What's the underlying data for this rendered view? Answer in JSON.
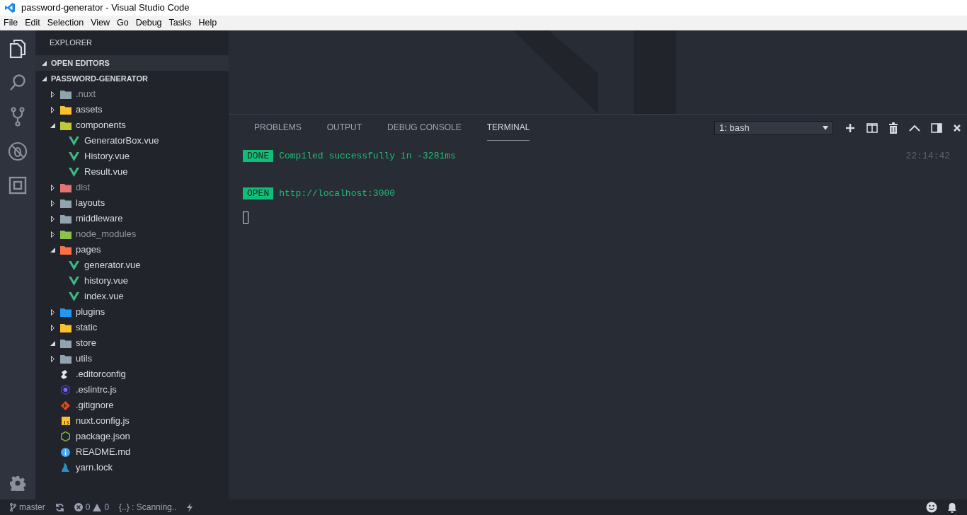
{
  "window": {
    "title": "password-generator - Visual Studio Code"
  },
  "menu": [
    "File",
    "Edit",
    "Selection",
    "View",
    "Go",
    "Debug",
    "Tasks",
    "Help"
  ],
  "sidebar": {
    "title": "EXPLORER",
    "sections": [
      {
        "label": "OPEN EDITORS",
        "expanded": true
      },
      {
        "label": "PASSWORD-GENERATOR",
        "expanded": true
      }
    ],
    "tree": [
      {
        "name": ".nuxt",
        "kind": "folder",
        "expanded": false,
        "ignored": true,
        "color": "#90a4ae"
      },
      {
        "name": "assets",
        "kind": "folder",
        "expanded": false,
        "ignored": false,
        "color": "#fbc02d"
      },
      {
        "name": "components",
        "kind": "folder",
        "expanded": true,
        "ignored": false,
        "color": "#c0ca33",
        "children": [
          {
            "name": "GeneratorBox.vue",
            "kind": "vue",
            "ignored": false
          },
          {
            "name": "History.vue",
            "kind": "vue",
            "ignored": false
          },
          {
            "name": "Result.vue",
            "kind": "vue",
            "ignored": false
          }
        ]
      },
      {
        "name": "dist",
        "kind": "folder",
        "expanded": false,
        "ignored": true,
        "color": "#e57373"
      },
      {
        "name": "layouts",
        "kind": "folder",
        "expanded": false,
        "ignored": false,
        "color": "#90a4ae"
      },
      {
        "name": "middleware",
        "kind": "folder",
        "expanded": false,
        "ignored": false,
        "color": "#90a4ae"
      },
      {
        "name": "node_modules",
        "kind": "folder",
        "expanded": false,
        "ignored": true,
        "color": "#8bc34a"
      },
      {
        "name": "pages",
        "kind": "folder",
        "expanded": true,
        "ignored": false,
        "color": "#ff7043",
        "children": [
          {
            "name": "generator.vue",
            "kind": "vue",
            "ignored": false
          },
          {
            "name": "history.vue",
            "kind": "vue",
            "ignored": false
          },
          {
            "name": "index.vue",
            "kind": "vue",
            "ignored": false
          }
        ]
      },
      {
        "name": "plugins",
        "kind": "folder",
        "expanded": false,
        "ignored": false,
        "color": "#2196f3"
      },
      {
        "name": "static",
        "kind": "folder",
        "expanded": false,
        "ignored": false,
        "color": "#fbc02d"
      },
      {
        "name": "store",
        "kind": "folder",
        "expanded": true,
        "ignored": false,
        "color": "#90a4ae"
      },
      {
        "name": "utils",
        "kind": "folder",
        "expanded": false,
        "ignored": false,
        "color": "#90a4ae"
      },
      {
        "name": ".editorconfig",
        "kind": "editorconfig",
        "ignored": false
      },
      {
        "name": ".eslintrc.js",
        "kind": "eslint",
        "ignored": false
      },
      {
        "name": ".gitignore",
        "kind": "git",
        "ignored": false
      },
      {
        "name": "nuxt.config.js",
        "kind": "js",
        "ignored": false
      },
      {
        "name": "package.json",
        "kind": "json",
        "ignored": false
      },
      {
        "name": "README.md",
        "kind": "info",
        "ignored": false
      },
      {
        "name": "yarn.lock",
        "kind": "yarn",
        "ignored": false
      }
    ]
  },
  "panel": {
    "tabs": [
      {
        "label": "PROBLEMS",
        "selected": false
      },
      {
        "label": "OUTPUT",
        "selected": false
      },
      {
        "label": "DEBUG CONSOLE",
        "selected": false
      },
      {
        "label": "TERMINAL",
        "selected": true
      }
    ],
    "terminal_select": "1: bash",
    "lines": [
      {
        "badge": "DONE",
        "text": "Compiled successfully in -3281ms",
        "time": "22:14:42"
      },
      {
        "badge": "OPEN",
        "text": "http://localhost:3000"
      }
    ]
  },
  "status_bar": {
    "branch": "master",
    "errors": "0",
    "warnings": "0",
    "scan": "{..} : Scanning.."
  }
}
